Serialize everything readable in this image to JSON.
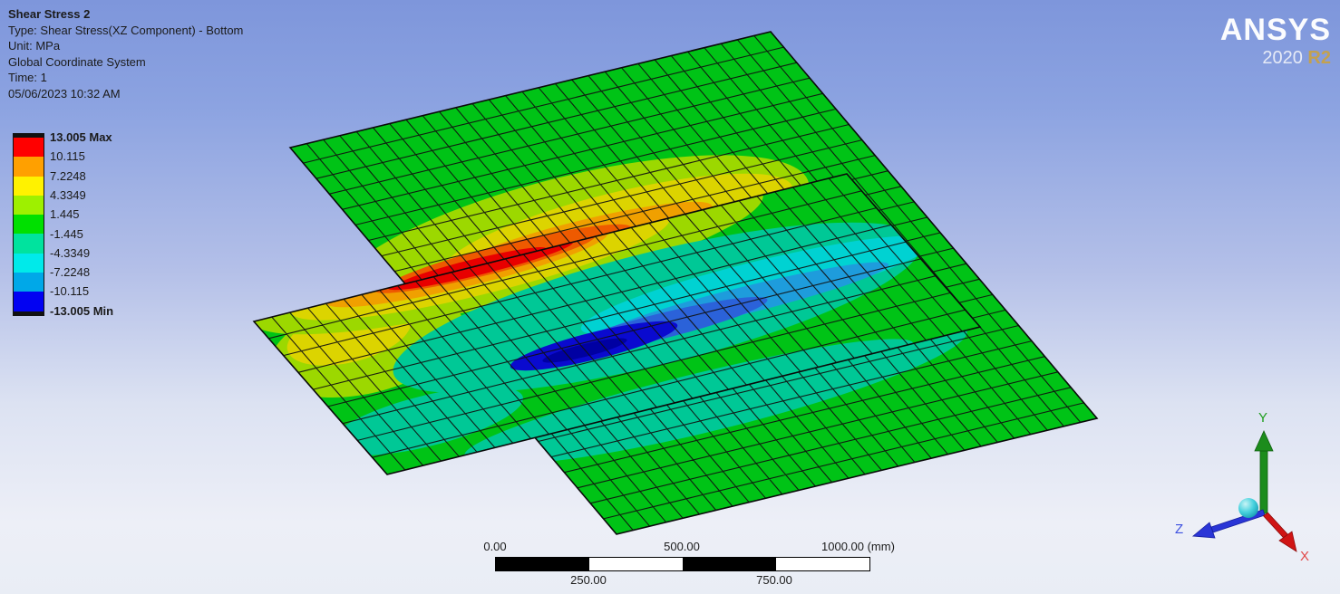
{
  "header": {
    "title": "Shear Stress 2",
    "type_line": "Type: Shear Stress(XZ Component) - Bottom",
    "unit_line": "Unit: MPa",
    "coord_line": "Global Coordinate System",
    "time_line": "Time: 1",
    "date_line": "05/06/2023 10:32 AM"
  },
  "logo": {
    "brand": "ANSYS",
    "version": "2020",
    "release": "R2"
  },
  "legend": {
    "labels": [
      "13.005 Max",
      "10.115",
      "7.2248",
      "4.3349",
      "1.445",
      "-1.445",
      "-4.3349",
      "-7.2248",
      "-10.115",
      "-13.005 Min"
    ],
    "band_colors": [
      "#FF0000",
      "#FFA000",
      "#FFF200",
      "#9EF000",
      "#00E000",
      "#00E39E",
      "#00EAEA",
      "#00A8E8",
      "#0202F2"
    ],
    "unit": "MPa",
    "max_value": "13.005",
    "min_value": "-13.005"
  },
  "scale_bar": {
    "top_labels": [
      "0.00",
      "500.00",
      "1000.00 (mm)"
    ],
    "bottom_labels": [
      "250.00",
      "750.00"
    ]
  },
  "triad": {
    "x_label": "X",
    "y_label": "Y",
    "z_label": "Z",
    "x_color": "#E14747",
    "y_color": "#1E9E1E",
    "z_color": "#3C50E0"
  }
}
